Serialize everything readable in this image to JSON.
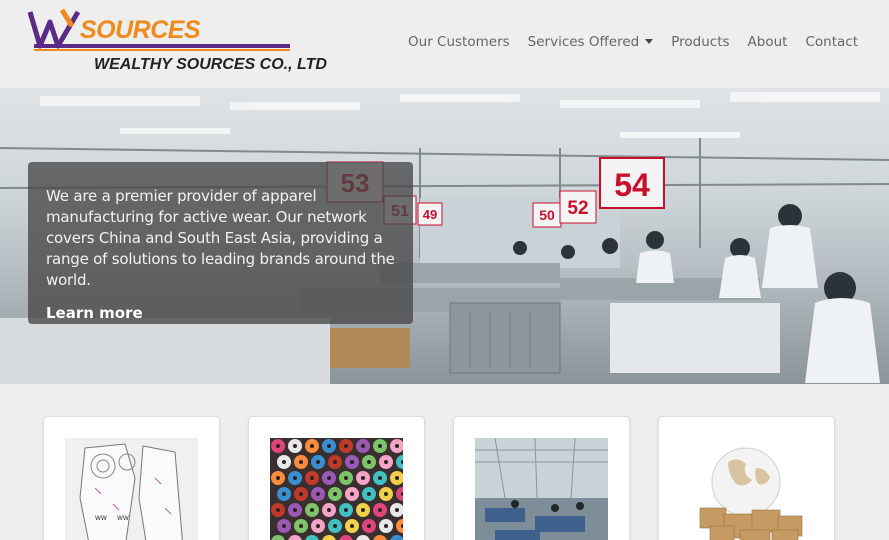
{
  "logo": {
    "brand": "SOURCES",
    "caption": "WEALTHY SOURCES CO., LTD"
  },
  "nav": {
    "items": [
      {
        "label": "Our Customers"
      },
      {
        "label": "Services Offered",
        "dropdown": true
      },
      {
        "label": "Products"
      },
      {
        "label": "About"
      },
      {
        "label": "Contact"
      }
    ]
  },
  "hero": {
    "text": "We are a premier provider of apparel manufacturing for active wear. Our network covers China and South East Asia, providing a range of solutions to leading brands around the world.",
    "link": "Learn more",
    "station_numbers": [
      "53",
      "51",
      "49",
      "50",
      "52",
      "54"
    ]
  },
  "cards": [
    {
      "image": "pattern-pieces"
    },
    {
      "image": "thread-spools"
    },
    {
      "image": "factory-floor"
    },
    {
      "image": "globe-boxes"
    }
  ],
  "colors": {
    "logo_purple": "#5b2a86",
    "logo_orange": "#f08a1c",
    "nav_text": "#666666",
    "sign_red": "#c8102e"
  }
}
